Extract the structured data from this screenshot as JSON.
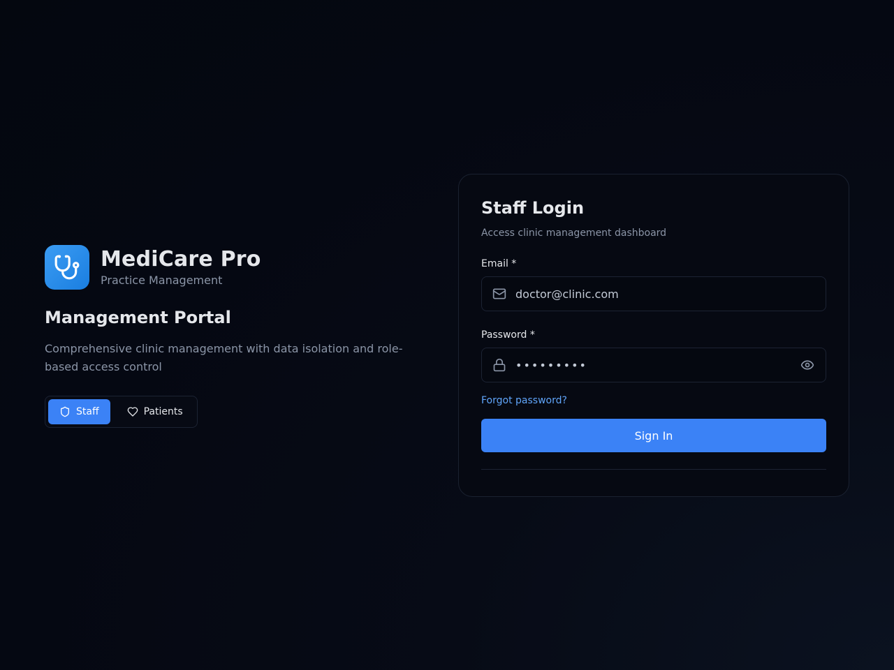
{
  "brand": {
    "name": "MediCare Pro",
    "subtitle": "Practice Management",
    "logo_icon": "stethoscope-icon",
    "logo_color": "#2a8ceb"
  },
  "portal": {
    "title": "Management Portal",
    "description": "Comprehensive clinic management with data isolation and role-based access control"
  },
  "role_switch": {
    "options": [
      {
        "label": "Staff",
        "icon": "shield-icon",
        "active": true
      },
      {
        "label": "Patients",
        "icon": "heart-icon",
        "active": false
      }
    ]
  },
  "login": {
    "title": "Staff Login",
    "subtitle": "Access clinic management dashboard",
    "email": {
      "label": "Email *",
      "value": "doctor@clinic.com",
      "icon": "mail-icon"
    },
    "password": {
      "label": "Password *",
      "value": "password1",
      "icon": "lock-icon",
      "toggle_icon": "eye-icon"
    },
    "forgot_label": "Forgot password?",
    "submit_label": "Sign In"
  },
  "colors": {
    "accent": "#3b82f6",
    "link": "#60a5fa",
    "background": "#050812"
  }
}
